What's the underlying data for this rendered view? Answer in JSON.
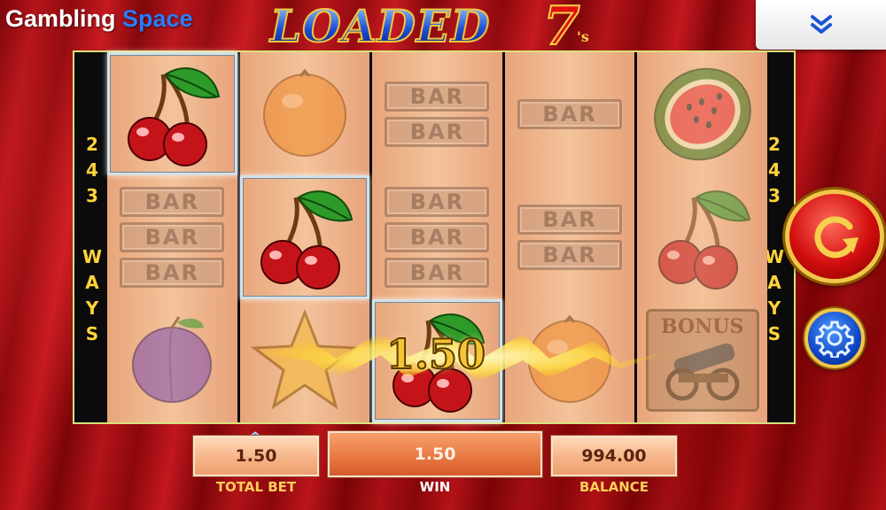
{
  "brand": {
    "name_part1": "Gambling",
    "name_part2": "Space"
  },
  "game": {
    "logo_word": "LOADED",
    "logo_seven": "7",
    "logo_suffix": "'s"
  },
  "ways": {
    "left": [
      "2",
      "4",
      "3",
      "W",
      "A",
      "Y",
      "S"
    ],
    "right": [
      "2",
      "4",
      "3",
      "W",
      "A",
      "Y",
      "S"
    ]
  },
  "reels": [
    {
      "symbols": [
        "cherry-icon",
        "bar-icon",
        "plum-icon"
      ],
      "bars": [
        null,
        [
          "BAR",
          "BAR",
          "BAR"
        ],
        null
      ],
      "win": [
        true,
        false,
        false
      ]
    },
    {
      "symbols": [
        "orange-icon",
        "cherry-icon",
        "star-icon"
      ],
      "bars": [
        null,
        null,
        null
      ],
      "win": [
        false,
        true,
        false
      ]
    },
    {
      "symbols": [
        "bar-icon",
        "bar-icon",
        "cherry-icon"
      ],
      "bars": [
        [
          "BAR",
          "BAR"
        ],
        [
          "BAR",
          "BAR",
          "BAR"
        ],
        null
      ],
      "win": [
        false,
        false,
        true
      ]
    },
    {
      "symbols": [
        "bar-icon",
        "bar-icon",
        "orange-icon"
      ],
      "bars": [
        [
          "BAR"
        ],
        [
          "BAR",
          "BAR"
        ],
        null
      ],
      "win": [
        false,
        false,
        false
      ]
    },
    {
      "symbols": [
        "watermelon-icon",
        "cherry-icon",
        "bonus-cannon-icon"
      ],
      "bars": [
        null,
        null,
        null
      ],
      "win": [
        false,
        false,
        false
      ],
      "bonus_label": "BONUS"
    }
  ],
  "win_overlay": {
    "amount": "1.50"
  },
  "controls": {
    "spin": "spin-icon",
    "settings": "gear-icon",
    "menu": "chevron-down-icon"
  },
  "bottom_bar": {
    "total_bet": {
      "value": "1.50",
      "label": "TOTAL BET"
    },
    "win": {
      "value": "1.50",
      "label": "WIN"
    },
    "balance": {
      "value": "994.00",
      "label": "BALANCE"
    }
  },
  "colors": {
    "accent_gold": "#ffd33a",
    "brand_blue": "#2b7bff",
    "spin_red": "#d10d0d",
    "settings_blue": "#1046c5"
  }
}
